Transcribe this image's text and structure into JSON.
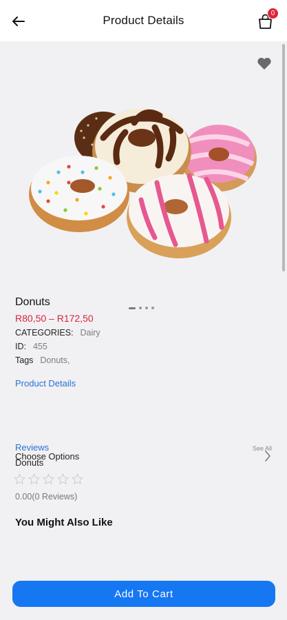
{
  "header": {
    "title": "Product Details",
    "cart_count": "0"
  },
  "product": {
    "name": "Donuts",
    "price": "R80,50 – R172,50",
    "categories_label": "CATEGORIES:",
    "categories_value": "Dairy",
    "id_label": "ID:",
    "id_value": "455",
    "tags_label": "Tags",
    "tags_value": "Donuts,",
    "details_link": "Product Details",
    "image_count": 4,
    "active_image": 1
  },
  "options": {
    "label": "Choose Options"
  },
  "reviews": {
    "link": "Reviews",
    "see_all": "See All",
    "product_name": "Donuts",
    "stars": 0,
    "summary": "0.00(0 Reviews)"
  },
  "section": {
    "also_like": "You Might Also Like"
  },
  "cta": {
    "add_to_cart": "Add To Cart"
  },
  "colors": {
    "accent": "#1677f2",
    "price": "#d8243a",
    "link": "#2b6fd6",
    "badge": "#e0243a"
  }
}
